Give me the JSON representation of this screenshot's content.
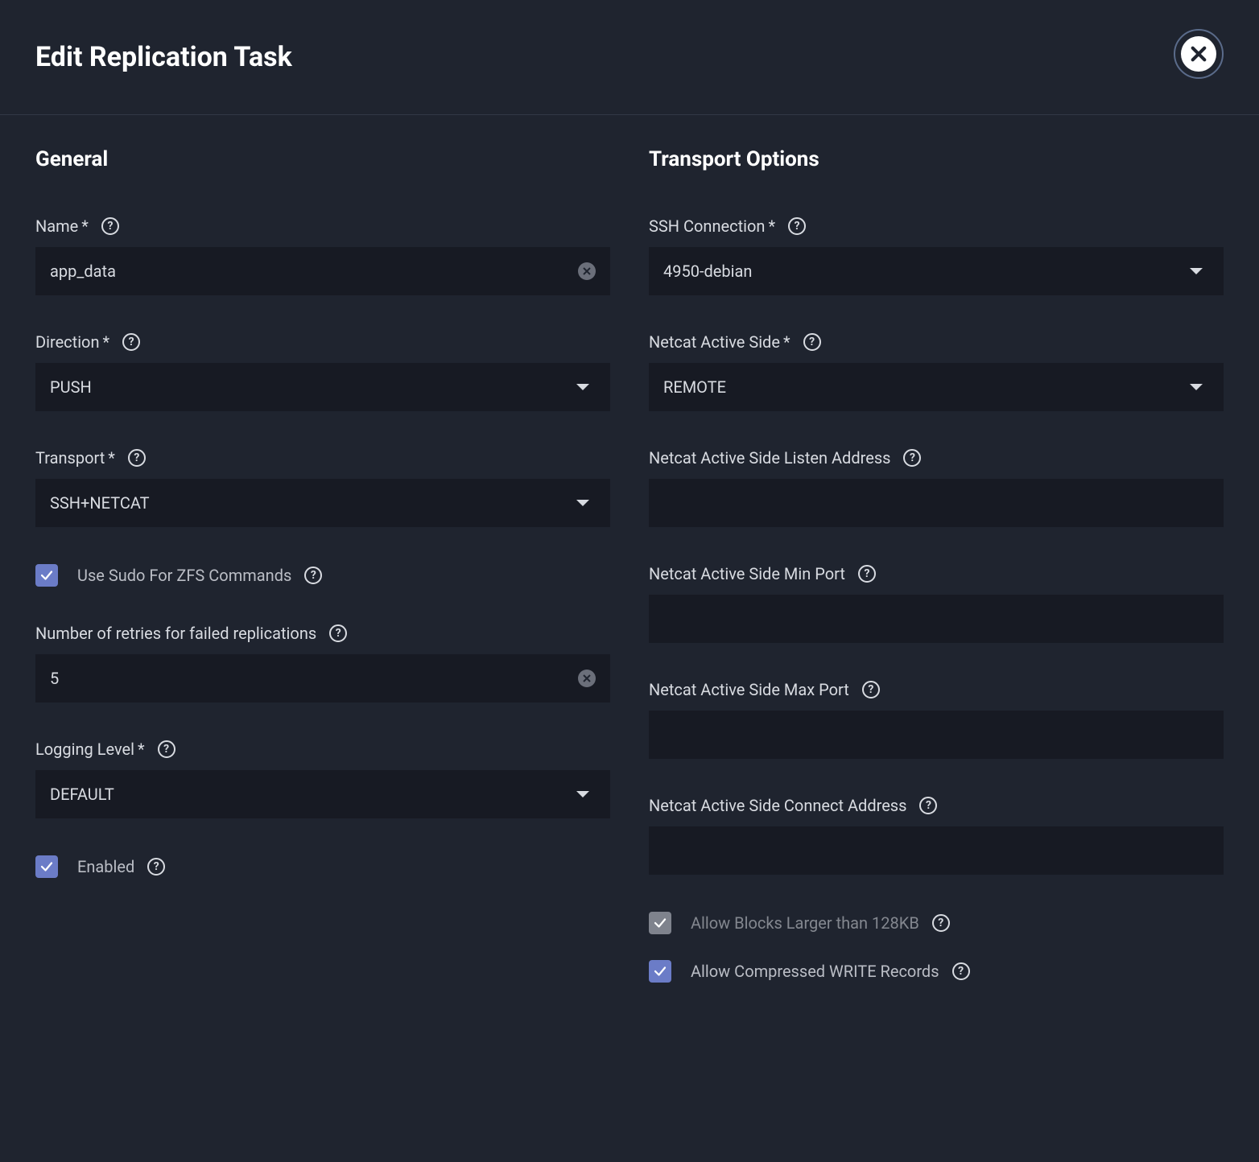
{
  "header": {
    "title": "Edit Replication Task"
  },
  "general": {
    "title": "General",
    "name": {
      "label": "Name",
      "required": true,
      "value": "app_data"
    },
    "direction": {
      "label": "Direction",
      "required": true,
      "value": "PUSH"
    },
    "transport": {
      "label": "Transport",
      "required": true,
      "value": "SSH+NETCAT"
    },
    "use_sudo": {
      "label": "Use Sudo For ZFS Commands",
      "checked": true
    },
    "retries": {
      "label": "Number of retries for failed replications",
      "value": "5"
    },
    "logging": {
      "label": "Logging Level",
      "required": true,
      "value": "DEFAULT"
    },
    "enabled": {
      "label": "Enabled",
      "checked": true
    }
  },
  "transport_options": {
    "title": "Transport Options",
    "ssh_connection": {
      "label": "SSH Connection",
      "required": true,
      "value": "4950-debian"
    },
    "netcat_active_side": {
      "label": "Netcat Active Side",
      "required": true,
      "value": "REMOTE"
    },
    "listen_address": {
      "label": "Netcat Active Side Listen Address",
      "value": ""
    },
    "min_port": {
      "label": "Netcat Active Side Min Port",
      "value": ""
    },
    "max_port": {
      "label": "Netcat Active Side Max Port",
      "value": ""
    },
    "connect_address": {
      "label": "Netcat Active Side Connect Address",
      "value": ""
    },
    "allow_large_blocks": {
      "label": "Allow Blocks Larger than 128KB",
      "checked": true,
      "disabled": true
    },
    "allow_compressed": {
      "label": "Allow Compressed WRITE Records",
      "checked": true
    }
  }
}
